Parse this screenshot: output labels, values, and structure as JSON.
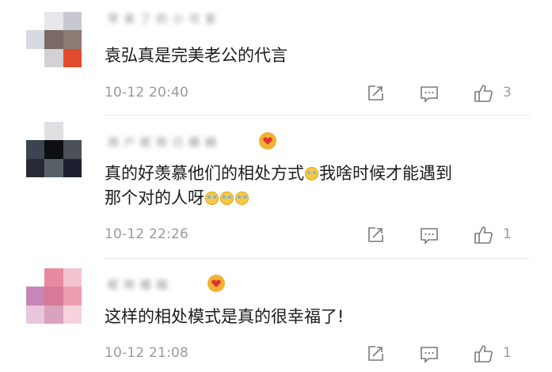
{
  "comments": [
    {
      "username": "早 来 了 的 小 可 爱",
      "text": "袁弘真是完美老公的代言",
      "time": "10-12 20:40",
      "likes": "3",
      "avatar_colors": [
        "#ffffff",
        "#e8e8ec",
        "#c8c8d0",
        "#d9d9e1",
        "#7a6a66",
        "#8e7b74",
        "#ffffff",
        "#d2d2d6",
        "#e24b2d"
      ]
    },
    {
      "username": "用 户 昵 称 已 模 糊",
      "text_parts": [
        "真的好羡慕他们的相处方式",
        "我啥时候才能遇到",
        "那个对的人呀"
      ],
      "time": "10-12 22:26",
      "likes": "1",
      "avatar_colors": [
        "#ffffff",
        "#e0e0e2",
        "#ffffff",
        "#3c4450",
        "#0d0f14",
        "#4b5058",
        "#2a2a36",
        "#5a6068",
        "#1c2030"
      ]
    },
    {
      "username": "昵 称 模 糊",
      "text": "这样的相处模式是真的很幸福了!",
      "time": "10-12 21:08",
      "likes": "1",
      "avatar_colors": [
        "#ffffff",
        "#e88aa2",
        "#f2c4d2",
        "#c487b6",
        "#d87a9a",
        "#ec9db0",
        "#e9c6dc",
        "#d9a2bd",
        "#f5d2dc"
      ]
    }
  ],
  "icons": {
    "share": "share-icon",
    "reply": "comment-icon",
    "like": "thumbs-up-icon",
    "badge": "heart-badge-icon"
  },
  "colors": {
    "text": "#1c1c1c",
    "meta": "#9a9a9a",
    "divider": "#e8e8e8",
    "badge": "#f2b233",
    "badge_heart": "#e03131"
  }
}
